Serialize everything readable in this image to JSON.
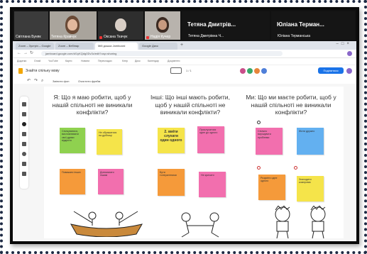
{
  "zoom": {
    "participants": [
      {
        "name": "Світлана Буняк"
      },
      {
        "name": "Тетяна Кравчук"
      },
      {
        "name": "Оксана Ткачук"
      },
      {
        "name": "Надія Кучер"
      }
    ],
    "featured": [
      {
        "display": "Тетяна Дмитрів...",
        "subname": "Тетяна Дмитрівна Ч..."
      },
      {
        "display": "Юліана Терман...",
        "subname": "Юліана Терманська"
      }
    ]
  },
  "browser": {
    "tabs": [
      "Zoom – Зустріч – Google",
      "Zoom – Вебінар",
      "Мій дошка Jamboard",
      "Google Диск"
    ],
    "url": "jamboard.google.com/d/1yKQdg0Dv3c/edit?usp=sharing",
    "bookmarks": [
      "Додатки",
      "Gmail",
      "YouTube",
      "Карти",
      "Новини",
      "Перекладач",
      "Keep",
      "Диск",
      "Календар",
      "Документи"
    ]
  },
  "app": {
    "title": "Знайти спільну мову",
    "frame_label": "1 / 1",
    "share_label": "Поділитися",
    "toolbar_labels": [
      "Змінити фон",
      "Очистити фрейм"
    ]
  },
  "board": {
    "columns": [
      {
        "header": "Я: Що я маю робити, щоб у нашій спільноті не виникали конфлікти?",
        "notes": [
          {
            "text": "Спілкуватися, висловлювати свої думки відкрито",
            "color": "#8fd14f"
          },
          {
            "text": "Не ображатися на дрібниці",
            "color": "#f5e44a"
          },
          {
            "text": "Поважати інших",
            "color": "#f59a3a"
          },
          {
            "text": "Допомагати іншим",
            "color": "#f26fae"
          }
        ]
      },
      {
        "header": "Інші: Що інші мають робити, щоб у нашій спільноті не виникали конфлікти?",
        "notes": [
          {
            "text": "2. вміти слухати один одного",
            "color": "#f5e44a"
          },
          {
            "text": "Прислухатися одне до одного",
            "color": "#f26fae"
          },
          {
            "text": "Бути толерантними",
            "color": "#f59a3a"
          },
          {
            "text": "Не кричати",
            "color": "#f26fae"
          }
        ]
      },
      {
        "header": "Ми: Що ми маєте робити, щоб у нашій спільноті не виникали конфлікти?",
        "notes": [
          {
            "text": "Спільно вирішувати проблеми",
            "color": "#f26fae"
          },
          {
            "text": "Жити дружно",
            "color": "#63b0f0"
          },
          {
            "text": "Розуміти одне одного",
            "color": "#f59a3a"
          },
          {
            "text": "Знаходити компроміс",
            "color": "#f5e44a"
          }
        ]
      }
    ]
  }
}
